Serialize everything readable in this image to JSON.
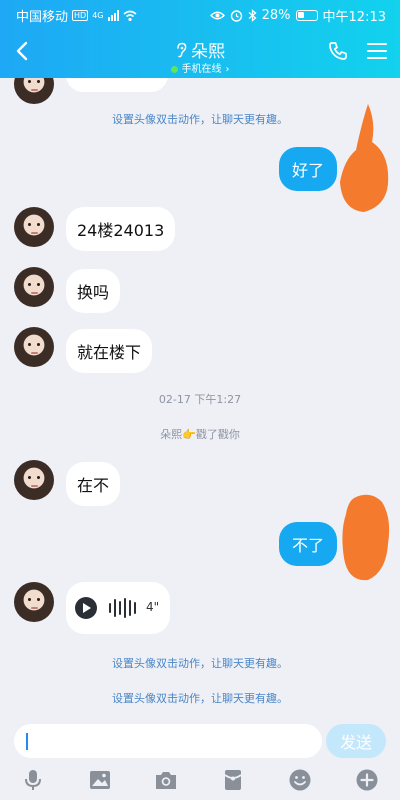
{
  "status_bar": {
    "carrier": "中国移动",
    "hd_badge": "HD",
    "network": "4G",
    "battery": "28%",
    "time": "中午12:13"
  },
  "header": {
    "contact_name": "朵熙",
    "presence": "手机在线",
    "presence_arrow": "›"
  },
  "messages": {
    "hint_1": "设置头像双击动作，让聊天更有趣。",
    "out_1": "好了",
    "in_1": "24楼24013",
    "in_2": "换吗",
    "in_3": "就在楼下",
    "timestamp": "02-17 下午1:27",
    "poke_name": "朵熙",
    "poke_emoji": "👉",
    "poke_text": "戳了戳你",
    "in_4": "在不",
    "out_2": "不了",
    "voice_duration": "4\"",
    "hint_2": "设置头像双击动作，让聊天更有趣。",
    "hint_3": "设置头像双击动作，让聊天更有趣。"
  },
  "input": {
    "value": "",
    "send_label": "发送"
  },
  "colors": {
    "header_start": "#1ea8f5",
    "header_end": "#12d2ee",
    "outgoing_bubble": "#16a9f2",
    "send_disabled": "#c3e7fb",
    "hint_link": "#4a86c7",
    "scribble": "#f47a2e"
  },
  "icons": [
    "back-arrow-icon",
    "hearing-icon",
    "phone-icon",
    "menu-icon",
    "play-icon",
    "microphone-icon",
    "image-icon",
    "camera-icon",
    "red-packet-icon",
    "emoji-icon",
    "plus-icon"
  ]
}
